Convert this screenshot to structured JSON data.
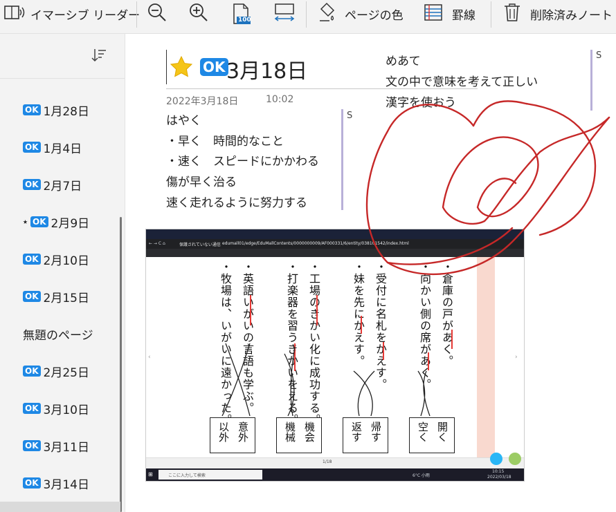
{
  "toolbar": {
    "immersive_reader": "イマーシブ リーダー",
    "page_color": "ページの色",
    "rule_lines": "罫線",
    "deleted_notes": "削除済みノート",
    "zoom_100": "100"
  },
  "sidebar": {
    "items": [
      {
        "label": "1月28日",
        "ok": true,
        "star": false
      },
      {
        "label": "1月4日",
        "ok": true,
        "star": false
      },
      {
        "label": "2月7日",
        "ok": true,
        "star": false
      },
      {
        "label": "2月9日",
        "ok": true,
        "star": true
      },
      {
        "label": "2月10日",
        "ok": true,
        "star": false
      },
      {
        "label": "2月15日",
        "ok": true,
        "star": false
      },
      {
        "label": "無題のページ",
        "ok": false,
        "star": false
      },
      {
        "label": "2月25日",
        "ok": true,
        "star": false
      },
      {
        "label": "3月10日",
        "ok": true,
        "star": false
      },
      {
        "label": "3月11日",
        "ok": true,
        "star": false
      },
      {
        "label": "3月14日",
        "ok": true,
        "star": false
      }
    ],
    "ok_text": "OK",
    "star_glyph": "⭑"
  },
  "page": {
    "ok_text": "OK",
    "title": "3月18日",
    "date": "2022年3月18日",
    "time": "10:02",
    "notes": [
      "はやく",
      "・早く　時間的なこと",
      "・速く　スピードにかかわる",
      "傷が早く治る",
      "速く走れるように努力する"
    ],
    "goal": [
      "めあて",
      "文の中で意味を考えて正しい",
      "漢字を使おう"
    ],
    "tag_s": "S"
  },
  "embedded": {
    "url": "edumall01/edge/EduMallContents/0000000009/AF000331/6/entity/038101542/index.html",
    "insecure_label": "保護されていない通信",
    "search_placeholder": "ここに入力して検索",
    "clock_time": "10:15",
    "clock_date": "2022/03/18",
    "weather": "6°C 小雨",
    "page_indicator": "1/18",
    "columns": [
      "・倉庫の戸があく。",
      "・向かい側の席があく。",
      "・受付に名札をかえす。",
      "・妹を先にかえす。",
      "・工場のきかい化に成功する。",
      "・打楽器を習うきかいをえる。",
      "・英語いがいの言語も学ぶ。",
      "・牧場は、いがいに遠かった。"
    ],
    "answers": [
      [
        "開く",
        "空く"
      ],
      [
        "帰す",
        "返す"
      ],
      [
        "機会",
        "機械"
      ],
      [
        "意外",
        "以外"
      ]
    ]
  },
  "colors": {
    "accent": "#1e88e5",
    "ink": "#c62828",
    "tag_bar": "#b8b0d8"
  }
}
